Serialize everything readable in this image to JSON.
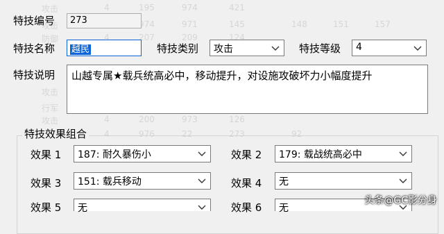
{
  "form": {
    "id_label": "特技编号",
    "id_value": "273",
    "name_label": "特技名称",
    "name_value": "越民",
    "type_label": "特技类别",
    "type_value": "攻击",
    "level_label": "特技等级",
    "level_value": "4",
    "desc_label": "特技说明",
    "desc_value": "山越专属★载兵统高必中，移动提升，对设施攻破坏力小幅度提升"
  },
  "effects": {
    "group_title": "特技效果组合",
    "items": [
      {
        "label": "效果 1",
        "value": "187: 耐久暴伤小"
      },
      {
        "label": "效果 2",
        "value": "179: 载战统高必中"
      },
      {
        "label": "效果 3",
        "value": "151: 载兵移动"
      },
      {
        "label": "效果 4",
        "value": "无"
      },
      {
        "label": "效果 5",
        "value": "无"
      },
      {
        "label": "效果 6",
        "value": "无"
      }
    ]
  },
  "watermark": "头条@GC影分身",
  "icons": {
    "dropdown": "chevron-down-icon"
  }
}
